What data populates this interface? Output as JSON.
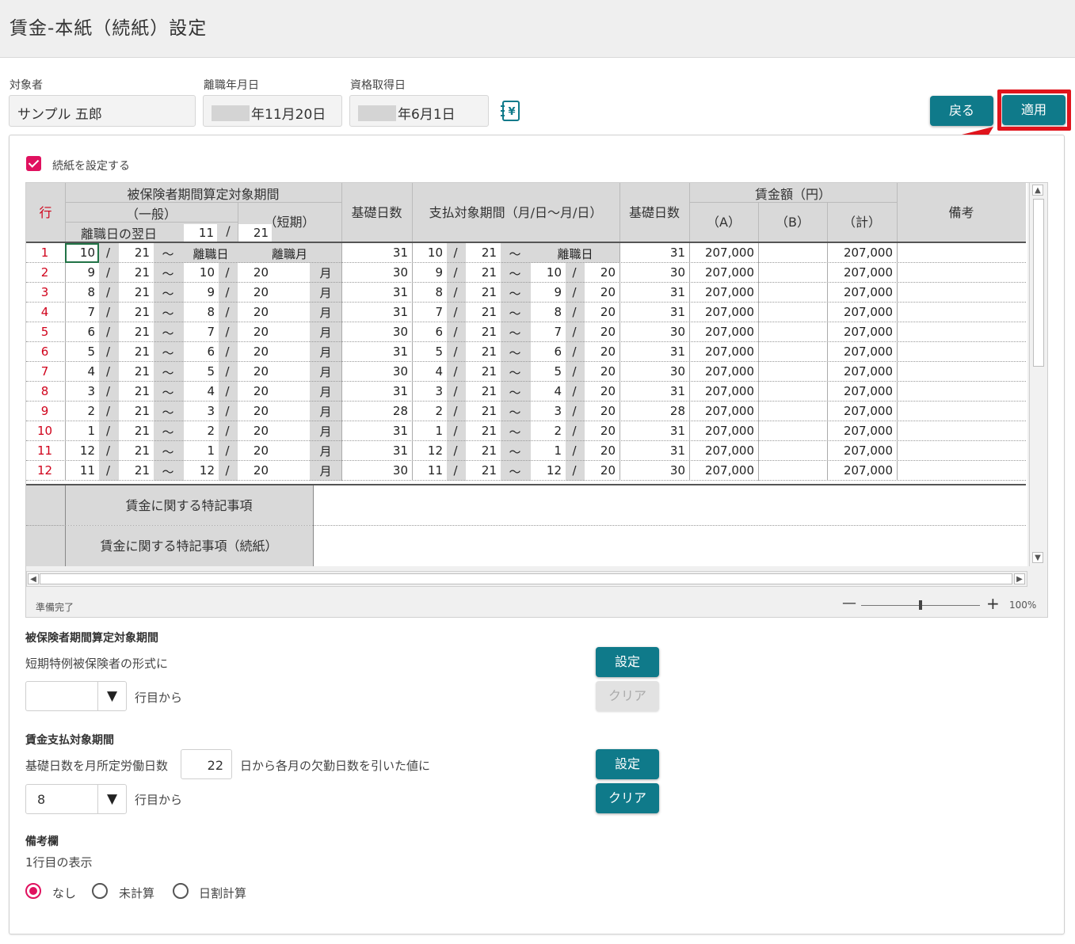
{
  "window": {
    "title": "賃金-本紙（続紙）設定"
  },
  "header": {
    "target_label": "対象者",
    "target_value": "サンプル 五郎",
    "retire_label": "離職年月日",
    "retire_value": "年11月20日",
    "qualify_label": "資格取得日",
    "qualify_value": "年6月1日",
    "back_label": "戻る",
    "apply_label": "適用"
  },
  "continuation": {
    "label": "続紙を設定する",
    "checked": true
  },
  "sheet": {
    "h_period": "被保険者期間算定対象期間",
    "h_general": "（一般）",
    "h_short": "（短期）",
    "h_nextday": "離職日の翌日",
    "h_nextday_m": "11",
    "h_nextday_d": "21",
    "h_row": "行",
    "h_basedays": "基礎日数",
    "h_payperiod": "支払対象期間（月/日～月/日）",
    "h_basedays2": "基礎日数",
    "h_wage": "賃金額（円）",
    "h_a": "（A）",
    "h_b": "（B）",
    "h_total": "（計）",
    "h_note": "備考",
    "retire_day": "離職日",
    "retire_month": "離職月",
    "month_char": "月",
    "slash": "/",
    "tilde": "～",
    "note1": "賃金に関する特記事項",
    "note2": "賃金に関する特記事項（続紙）",
    "rows": [
      {
        "no": "1",
        "gm1": "10",
        "gd1": "21",
        "gm2": "",
        "gd2": "",
        "bd": "31",
        "pm1": "10",
        "pd1": "21",
        "pm2": "",
        "pd2": "",
        "bd2": "31",
        "a": "207,000",
        "b": "",
        "t": "207,000"
      },
      {
        "no": "2",
        "gm1": "9",
        "gd1": "21",
        "gm2": "10",
        "gd2": "20",
        "bd": "30",
        "pm1": "9",
        "pd1": "21",
        "pm2": "10",
        "pd2": "20",
        "bd2": "30",
        "a": "207,000",
        "b": "",
        "t": "207,000"
      },
      {
        "no": "3",
        "gm1": "8",
        "gd1": "21",
        "gm2": "9",
        "gd2": "20",
        "bd": "31",
        "pm1": "8",
        "pd1": "21",
        "pm2": "9",
        "pd2": "20",
        "bd2": "31",
        "a": "207,000",
        "b": "",
        "t": "207,000"
      },
      {
        "no": "4",
        "gm1": "7",
        "gd1": "21",
        "gm2": "8",
        "gd2": "20",
        "bd": "31",
        "pm1": "7",
        "pd1": "21",
        "pm2": "8",
        "pd2": "20",
        "bd2": "31",
        "a": "207,000",
        "b": "",
        "t": "207,000"
      },
      {
        "no": "5",
        "gm1": "6",
        "gd1": "21",
        "gm2": "7",
        "gd2": "20",
        "bd": "30",
        "pm1": "6",
        "pd1": "21",
        "pm2": "7",
        "pd2": "20",
        "bd2": "30",
        "a": "207,000",
        "b": "",
        "t": "207,000"
      },
      {
        "no": "6",
        "gm1": "5",
        "gd1": "21",
        "gm2": "6",
        "gd2": "20",
        "bd": "31",
        "pm1": "5",
        "pd1": "21",
        "pm2": "6",
        "pd2": "20",
        "bd2": "31",
        "a": "207,000",
        "b": "",
        "t": "207,000"
      },
      {
        "no": "7",
        "gm1": "4",
        "gd1": "21",
        "gm2": "5",
        "gd2": "20",
        "bd": "30",
        "pm1": "4",
        "pd1": "21",
        "pm2": "5",
        "pd2": "20",
        "bd2": "30",
        "a": "207,000",
        "b": "",
        "t": "207,000"
      },
      {
        "no": "8",
        "gm1": "3",
        "gd1": "21",
        "gm2": "4",
        "gd2": "20",
        "bd": "31",
        "pm1": "3",
        "pd1": "21",
        "pm2": "4",
        "pd2": "20",
        "bd2": "31",
        "a": "207,000",
        "b": "",
        "t": "207,000"
      },
      {
        "no": "9",
        "gm1": "2",
        "gd1": "21",
        "gm2": "3",
        "gd2": "20",
        "bd": "28",
        "pm1": "2",
        "pd1": "21",
        "pm2": "3",
        "pd2": "20",
        "bd2": "28",
        "a": "207,000",
        "b": "",
        "t": "207,000"
      },
      {
        "no": "10",
        "gm1": "1",
        "gd1": "21",
        "gm2": "2",
        "gd2": "20",
        "bd": "31",
        "pm1": "1",
        "pd1": "21",
        "pm2": "2",
        "pd2": "20",
        "bd2": "31",
        "a": "207,000",
        "b": "",
        "t": "207,000"
      },
      {
        "no": "11",
        "gm1": "12",
        "gd1": "21",
        "gm2": "1",
        "gd2": "20",
        "bd": "31",
        "pm1": "12",
        "pd1": "21",
        "pm2": "1",
        "pd2": "20",
        "bd2": "31",
        "a": "207,000",
        "b": "",
        "t": "207,000"
      },
      {
        "no": "12",
        "gm1": "11",
        "gd1": "21",
        "gm2": "12",
        "gd2": "20",
        "bd": "30",
        "pm1": "11",
        "pd1": "21",
        "pm2": "12",
        "pd2": "20",
        "bd2": "30",
        "a": "207,000",
        "b": "",
        "t": "207,000"
      }
    ]
  },
  "statusbar": {
    "text": "準備完了",
    "zoom": "100%",
    "zoom_level": 0.5
  },
  "section1": {
    "title": "被保険者期間算定対象期間",
    "desc": "短期特例被保険者の形式に",
    "select_value": "",
    "from_row": "行目から",
    "set_label": "設定",
    "clear_label": "クリア"
  },
  "section2": {
    "title": "賃金支払対象期間",
    "desc_pre": "基礎日数を月所定労働日数",
    "days_value": "22",
    "desc_post": "日から各月の欠勤日数を引いた値に",
    "select_value": "8",
    "from_row": "行目から",
    "set_label": "設定",
    "clear_label": "クリア"
  },
  "section3": {
    "title": "備考欄",
    "desc": "1行目の表示",
    "options": [
      "なし",
      "未計算",
      "日割計算"
    ],
    "selected": 0
  },
  "colors": {
    "accent": "#0f7a8a",
    "highlight": "#e0141c",
    "check": "#e0115f"
  },
  "icons": {
    "calc": "calculator-yen-icon",
    "dropdown": "triangle-down-icon"
  }
}
